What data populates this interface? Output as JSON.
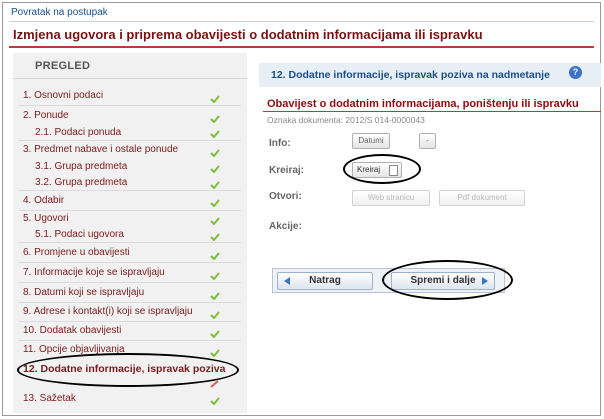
{
  "header": {
    "back_link": "Povratak na postupak",
    "title": "Izmjena ugovora i priprema obavijesti o dodatnim informacijama ili ispravku"
  },
  "sidebar": {
    "heading": "PREGLED",
    "items": [
      {
        "label": "1. Osnovni podaci"
      },
      {
        "label": "2. Ponude"
      },
      {
        "label": "2.1. Podaci ponuda"
      },
      {
        "label": "3. Predmet nabave i ostale ponude"
      },
      {
        "label": "3.1. Grupa predmeta"
      },
      {
        "label": "3.2. Grupa predmeta"
      },
      {
        "label": "4. Odabir"
      },
      {
        "label": "5. Ugovori"
      },
      {
        "label": "5.1. Podaci ugovora"
      },
      {
        "label": "6. Promjene u obavijesti"
      },
      {
        "label": "7. Informacije koje se ispravljaju"
      },
      {
        "label": "8. Datumi koji se ispravljaju"
      },
      {
        "label": "9. Adrese i kontakt(i) koji se ispravljaju"
      },
      {
        "label": "10. Dodatak obavijesti"
      },
      {
        "label": "11. Opcije objavljivanja"
      },
      {
        "label": "12. Dodatne informacije, ispravak poziva"
      },
      {
        "label": "13. Sažetak"
      }
    ]
  },
  "panel": {
    "heading": "12. Dodatne informacije, ispravak poziva na nadmetanje",
    "help_glyph": "?",
    "section_title": "Obavijest o dodatnim informacijama, poništenju ili ispravku",
    "doc_mark": "Oznaka dokumenta: 2012/S 014-0000043",
    "info_label": "Info:",
    "dates_button": "Datumi",
    "minus_button": "-",
    "create_label": "Kreiraj:",
    "create_button": "Kreiraj",
    "open_label": "Otvori:",
    "web_button": "Web stranicu",
    "pdf_button": "Pdf dokument",
    "actions_label": "Akcije:"
  },
  "nav": {
    "back_button": "Natrag",
    "next_button": "Spremi i dalje"
  },
  "colors": {
    "title": "#7b1010",
    "link": "#1a4f8a",
    "check": "#7cbf3a",
    "annotation": "#000000"
  }
}
